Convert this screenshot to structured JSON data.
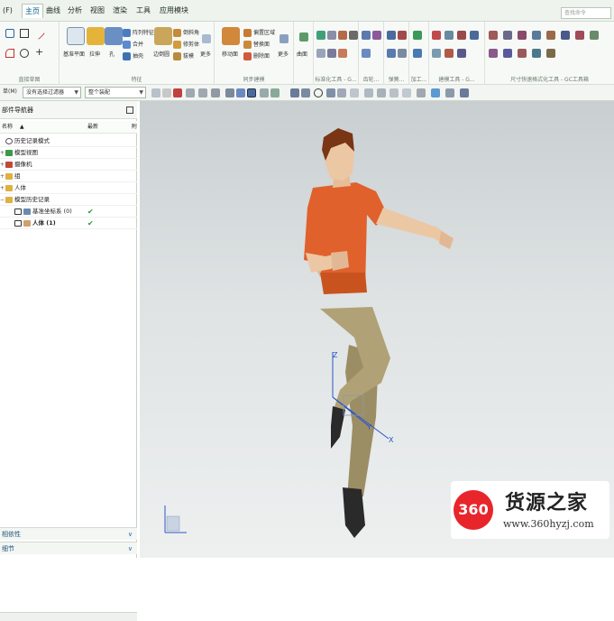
{
  "menubar": {
    "file_tab": "(F)",
    "tabs": [
      "主页",
      "曲线",
      "分析",
      "视图",
      "渲染",
      "工具",
      "应用模块"
    ],
    "search_placeholder": "查找命令"
  },
  "ribbon": {
    "groups": [
      "直接草图",
      "特征",
      "同步建模",
      "标准化工具 - G...",
      "齿轮...",
      "弹簧...",
      "加工...",
      "建模工具 - G...",
      "尺寸快速格式化工具 - GC工具箱"
    ],
    "tools": {
      "datum_plane": "基准平面",
      "extrude": "拉伸",
      "hole": "孔",
      "array_feature": "阵列特征",
      "unite": "合并",
      "shell": "抽壳",
      "edge_blend": "边倒圆",
      "chamfer": "倒斜角",
      "trim_body": "修剪体",
      "draft": "拔模",
      "more": "更多",
      "move_face": "移动面",
      "offset_region": "偏置区域",
      "replace_face": "替换面",
      "delete_face": "删除面",
      "surface": "曲面"
    }
  },
  "toolbar2": {
    "menu_label": "单(M)",
    "filter_value": "没有选择过滤器",
    "scope_value": "整个装配"
  },
  "navigator": {
    "title": "部件导航器",
    "columns": [
      "名称",
      "最新",
      "附"
    ],
    "rows": [
      {
        "label": "历史记录模式",
        "indent": 0,
        "check": ""
      },
      {
        "label": "模型视图",
        "indent": 0,
        "check": ""
      },
      {
        "label": "摄像机",
        "indent": 0,
        "check": ""
      },
      {
        "label": "组",
        "indent": 0,
        "check": ""
      },
      {
        "label": "人体",
        "indent": 0,
        "check": ""
      },
      {
        "label": "模型历史记录",
        "indent": 0,
        "check": ""
      },
      {
        "label": "基准坐标系 (0)",
        "indent": 1,
        "check": "✔"
      },
      {
        "label": "人体 (1)",
        "indent": 1,
        "check": "✔"
      }
    ],
    "panels": [
      "相依性",
      "细节"
    ]
  },
  "viewport": {
    "axis_labels": {
      "z": "Z",
      "y": "Y",
      "x": "X"
    }
  },
  "watermark": {
    "logo_text": "360",
    "title": "货源之家",
    "url": "www.360hyzj.com"
  },
  "colors": {
    "shirt": "#e0612c",
    "pants": "#a89a70",
    "skin": "#ecc7a4",
    "hair": "#7a3514",
    "shoe": "#2a2a2a",
    "check": "#2a9a2a",
    "accent": "#0b5f8a",
    "watermark_red": "#e8252b"
  }
}
